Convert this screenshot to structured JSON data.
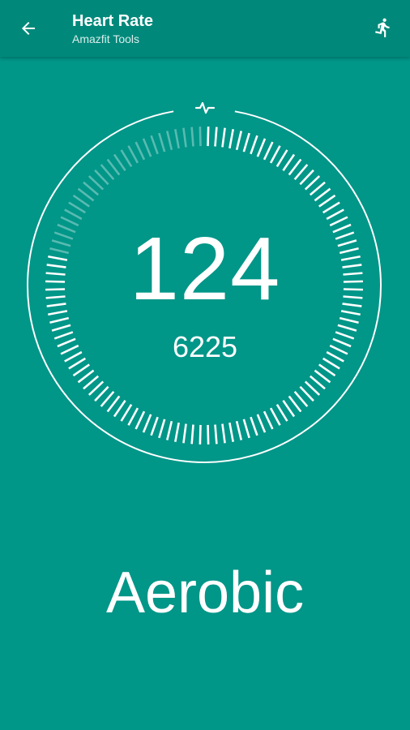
{
  "toolbar": {
    "title": "Heart Rate",
    "subtitle": "Amazfit Tools",
    "back_icon": "arrow-left-icon",
    "action_icon": "running-person-icon"
  },
  "gauge": {
    "heart_rate": "124",
    "secondary_value": "6225",
    "progress_fraction": 0.78,
    "top_icon": "pulse-icon"
  },
  "zone_label": "Aerobic",
  "colors": {
    "background": "#009688",
    "toolbar": "#00897b",
    "foreground": "#ffffff"
  }
}
